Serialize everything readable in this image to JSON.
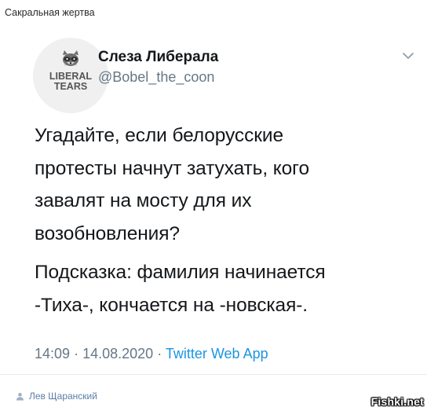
{
  "post": {
    "title": "Сакральная жертва",
    "author": "Лев Щаранский",
    "author_icon": "user-icon"
  },
  "tweet": {
    "avatar_text_line1": "LIBERAL",
    "avatar_text_line2": "TEARS",
    "display_name": "Слеза Либерала",
    "handle": "@Bobel_the_coon",
    "more_icon": "chevron-down-icon",
    "paragraphs": [
      {
        "lines": [
          "Угадайте, если белорусские",
          "протесты начнут затухать, кого",
          "завалят на мосту для их",
          "возобновления?"
        ]
      },
      {
        "lines": [
          "Подсказка: фамилия начинается",
          "-Тиха-, кончается на -новская-."
        ]
      }
    ],
    "time": "14:09",
    "separator": "·",
    "date": "14.08.2020",
    "source_app": "Twitter Web App"
  },
  "watermark": "Fishki.net",
  "colors": {
    "text": "#14171a",
    "muted": "#657786",
    "link": "#1b95e0",
    "author_link": "#5b7ea6"
  }
}
